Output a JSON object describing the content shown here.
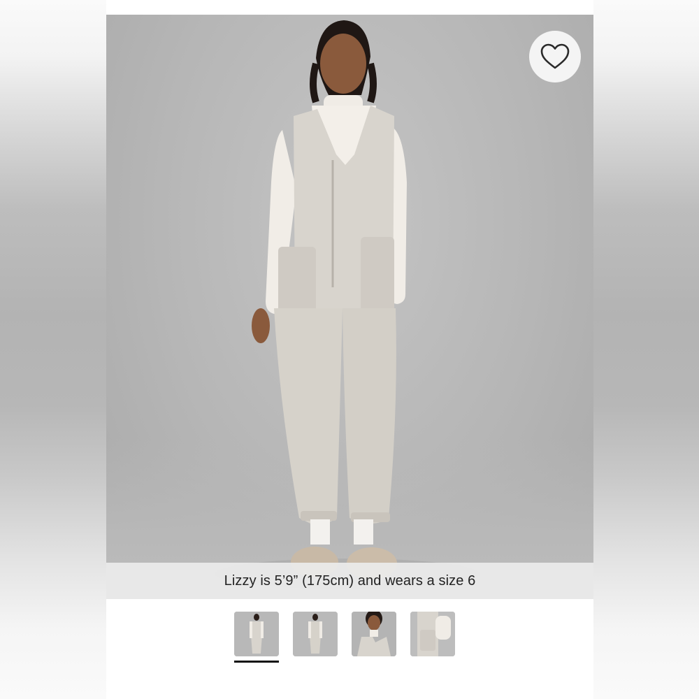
{
  "product_gallery": {
    "caption": "Lizzy is 5’9” (175cm) and wears a size 6",
    "wishlist_icon": "heart-icon",
    "thumbnails": [
      {
        "view": "front-full"
      },
      {
        "view": "front-full-alt"
      },
      {
        "view": "detail-closeup"
      },
      {
        "view": "side-pocket-detail"
      }
    ],
    "active_thumbnail": 1
  },
  "colors": {
    "background": "#b8b8b8",
    "garment": "#d9d5cf",
    "caption_bar": "#ececec",
    "active_indicator": "#111111"
  }
}
